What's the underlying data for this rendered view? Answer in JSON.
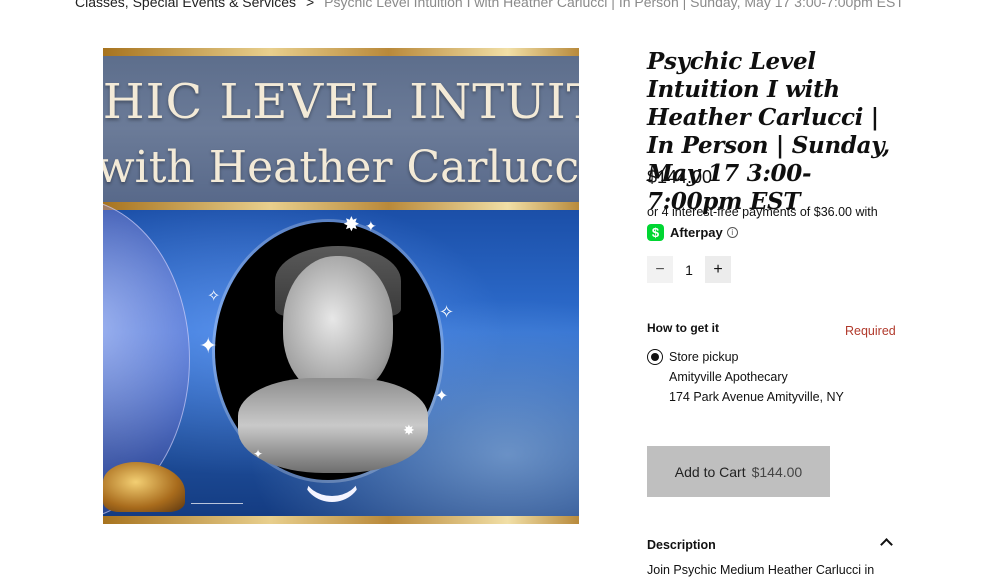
{
  "breadcrumb": {
    "parent": "Classes, Special Events & Services",
    "separator": ">",
    "current": "Psychic Level Intuition I with Heather Carlucci | In Person | Sunday, May 17 3:00-7:00pm EST"
  },
  "product_image": {
    "title_line1": "CHIC LEVEL INTUITION",
    "title_line2": "with Heather Carlucci"
  },
  "product": {
    "title": "Psychic Level Intuition I with Heather Carlucci | In Person | Sunday, May 17 3:00-7:00pm EST",
    "price": "$144.00"
  },
  "afterpay": {
    "text": "or 4 interest-free payments of $36.00 with",
    "icon_glyph": "$",
    "label": "Afterpay",
    "info_glyph": "i",
    "brand_color": "#00d632"
  },
  "quantity": {
    "minus": "−",
    "value": "1",
    "plus": "+"
  },
  "fulfillment": {
    "label": "How to get it",
    "required": "Required",
    "option_title": "Store pickup",
    "store": "Amityville Apothecary",
    "address": "174 Park Avenue Amityville, NY"
  },
  "cart": {
    "label": "Add to Cart",
    "price": "$144.00"
  },
  "description": {
    "label": "Description",
    "snippet": "Join Psychic Medium Heather Carlucci in"
  },
  "colors": {
    "required_text": "#b13a2c",
    "button_bg": "#bfbfbf"
  }
}
